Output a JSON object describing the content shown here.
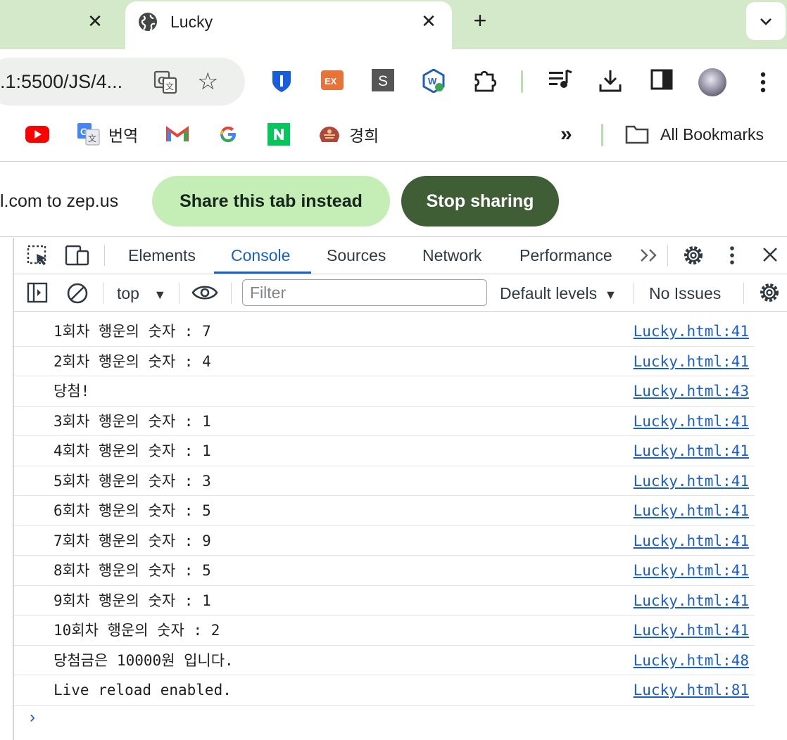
{
  "browser": {
    "prev_tab_close": "✕",
    "active_tab": {
      "title": "Lucky",
      "close": "✕"
    },
    "new_tab": "+",
    "url": ".1:5500/JS/4...",
    "bookmarks": [
      {
        "label": "",
        "icon": "youtube-icon"
      },
      {
        "label": "번역",
        "icon": "google-translate-icon"
      },
      {
        "label": "",
        "icon": "gmail-icon"
      },
      {
        "label": "",
        "icon": "google-icon"
      },
      {
        "label": "",
        "icon": "naver-icon"
      },
      {
        "label": "경희",
        "icon": "khu-icon"
      }
    ],
    "overflow": "»",
    "all_bookmarks": "All Bookmarks"
  },
  "share_bar": {
    "message": "l.com to zep.us",
    "share_button": "Share this tab instead",
    "stop_button": "Stop sharing"
  },
  "devtools": {
    "tabs": [
      "Elements",
      "Console",
      "Sources",
      "Network",
      "Performance"
    ],
    "active_tab": "Console",
    "context": "top",
    "filter_placeholder": "Filter",
    "levels": "Default levels",
    "issues": "No Issues",
    "console_rows": [
      {
        "message": "1회차 행운의 숫자 : 7",
        "source": "Lucky.html:41"
      },
      {
        "message": "2회차 행운의 숫자 : 4",
        "source": "Lucky.html:41"
      },
      {
        "message": "당첨!",
        "source": "Lucky.html:43"
      },
      {
        "message": "3회차 행운의 숫자 : 1",
        "source": "Lucky.html:41"
      },
      {
        "message": "4회차 행운의 숫자 : 1",
        "source": "Lucky.html:41"
      },
      {
        "message": "5회차 행운의 숫자 : 3",
        "source": "Lucky.html:41"
      },
      {
        "message": "6회차 행운의 숫자 : 5",
        "source": "Lucky.html:41"
      },
      {
        "message": "7회차 행운의 숫자 : 9",
        "source": "Lucky.html:41"
      },
      {
        "message": "8회차 행운의 숫자 : 5",
        "source": "Lucky.html:41"
      },
      {
        "message": "9회차 행운의 숫자 : 1",
        "source": "Lucky.html:41"
      },
      {
        "message": "10회차 행운의 숫자 : 2",
        "source": "Lucky.html:41"
      },
      {
        "message": "당첨금은 10000원 입니다.",
        "source": "Lucky.html:48"
      },
      {
        "message": "Live reload enabled.",
        "source": "Lucky.html:81"
      }
    ],
    "prompt": "›"
  },
  "colors": {
    "tabstrip": "#d3e9c9",
    "accent_blue": "#1a5fc7",
    "share_button": "#c4eeb6",
    "stop_button": "#3f5e36"
  }
}
